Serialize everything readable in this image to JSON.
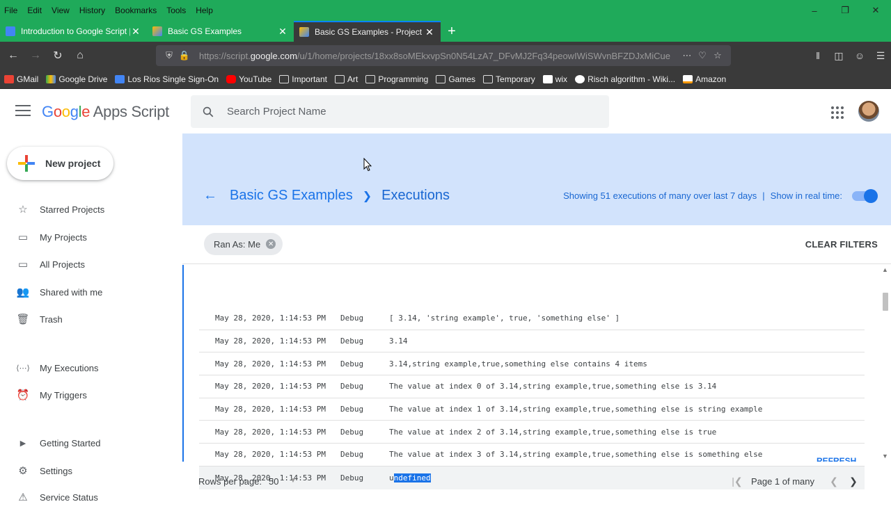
{
  "browser": {
    "menu": [
      "File",
      "Edit",
      "View",
      "History",
      "Bookmarks",
      "Tools",
      "Help"
    ],
    "tabs": [
      {
        "title": "Introduction to Google Script |",
        "favicon_color": "#4285f4"
      },
      {
        "title": "Basic GS Examples",
        "favicon_color": "#fbbc05"
      },
      {
        "title": "Basic GS Examples - Project Exe",
        "favicon_color": "#fbbc05",
        "active": true
      }
    ],
    "url_prefix": "https://script.",
    "url_domain": "google.com",
    "url_rest": "/u/1/home/projects/18xx8soMEkxvpSn0N54LzA7_DFvMJ2Fq34peowIWiSWvnBFZDJxMiCue",
    "bookmarks": [
      {
        "label": "GMail",
        "color": "#ea4335"
      },
      {
        "label": "Google Drive",
        "color": "#fbbc05"
      },
      {
        "label": "Los Rios Single Sign-On",
        "color": "#4285f4"
      },
      {
        "label": "YouTube",
        "color": "#ff0000"
      },
      {
        "label": "Important",
        "color": "folder"
      },
      {
        "label": "Art",
        "color": "folder"
      },
      {
        "label": "Programming",
        "color": "folder"
      },
      {
        "label": "Games",
        "color": "folder"
      },
      {
        "label": "Temporary",
        "color": "folder"
      },
      {
        "label": "wix",
        "color": "#ffffff"
      },
      {
        "label": "Risch algorithm - Wiki...",
        "color": "#ffffff"
      },
      {
        "label": "Amazon",
        "color": "#ff9900"
      }
    ]
  },
  "app": {
    "logo_google": [
      "G",
      "o",
      "o",
      "g",
      "l",
      "e"
    ],
    "logo_product": "Apps Script",
    "search_placeholder": "Search Project Name",
    "new_project": "New project",
    "nav": [
      {
        "label": "Starred Projects",
        "icon": "☆"
      },
      {
        "label": "My Projects",
        "icon": "▭"
      },
      {
        "label": "All Projects",
        "icon": "▭"
      },
      {
        "label": "Shared with me",
        "icon": "👥"
      },
      {
        "label": "Trash",
        "icon": "🗑"
      },
      {
        "label": "My Executions",
        "icon": "⟨⋯⟩"
      },
      {
        "label": "My Triggers",
        "icon": "⏰"
      },
      {
        "label": "Getting Started",
        "icon": "▶"
      },
      {
        "label": "Settings",
        "icon": "⚙"
      },
      {
        "label": "Service Status",
        "icon": "⚠"
      }
    ],
    "breadcrumb": {
      "project": "Basic GS Examples",
      "page": "Executions"
    },
    "showing_text": "Showing 51 executions of many over last 7 days",
    "realtime_label": "Show in real time:",
    "realtime_on": true,
    "filter_chip": "Ran As: Me",
    "clear_filters": "CLEAR FILTERS",
    "logs": [
      {
        "time": "May 28, 2020, 1:14:53 PM",
        "level": "Debug",
        "message": "[ 3.14, 'string example', true, 'something else' ]"
      },
      {
        "time": "May 28, 2020, 1:14:53 PM",
        "level": "Debug",
        "message": "3.14"
      },
      {
        "time": "May 28, 2020, 1:14:53 PM",
        "level": "Debug",
        "message": "3.14,string example,true,something else contains 4 items"
      },
      {
        "time": "May 28, 2020, 1:14:53 PM",
        "level": "Debug",
        "message": "The value at index 0 of 3.14,string example,true,something else is 3.14"
      },
      {
        "time": "May 28, 2020, 1:14:53 PM",
        "level": "Debug",
        "message": "The value at index 1 of 3.14,string example,true,something else is string example"
      },
      {
        "time": "May 28, 2020, 1:14:53 PM",
        "level": "Debug",
        "message": "The value at index 2 of 3.14,string example,true,something else is true"
      },
      {
        "time": "May 28, 2020, 1:14:53 PM",
        "level": "Debug",
        "message": "The value at index 3 of 3.14,string example,true,something else is something else"
      },
      {
        "time": "May 28, 2020, 1:14:53 PM",
        "level": "Debug",
        "message_pre": "u",
        "message_sel": "ndefined"
      }
    ],
    "refresh": "REFRESH",
    "rows_per_page_label": "Rows per page:",
    "rows_per_page": "50",
    "page_text": "Page 1 of many"
  }
}
